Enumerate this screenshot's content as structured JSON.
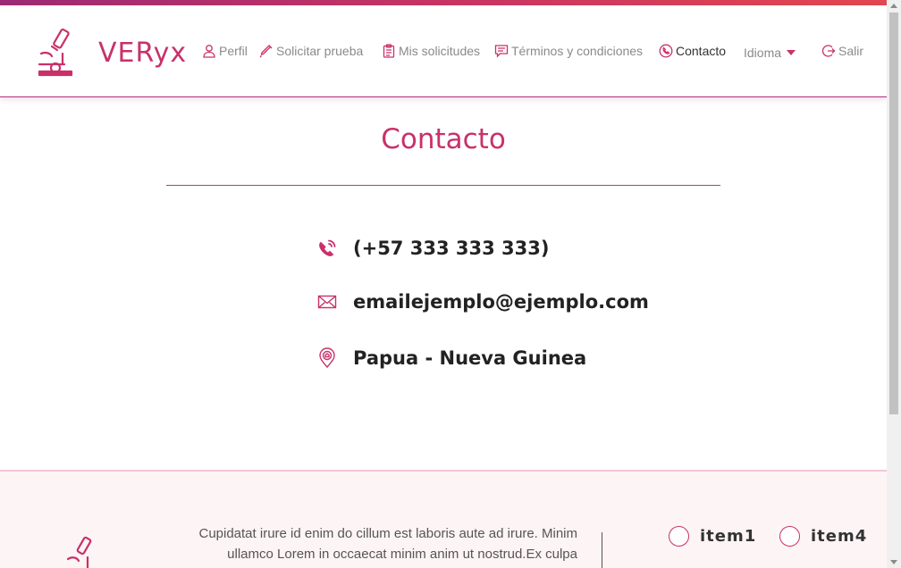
{
  "brand": {
    "name": "VERyx",
    "logo_icon": "microscope-icon"
  },
  "nav": {
    "items": [
      {
        "label": "Perfil",
        "icon": "user-icon"
      },
      {
        "label": "Solicitar prueba",
        "icon": "syringe-icon"
      },
      {
        "label": "Mis solicitudes",
        "icon": "clipboard-icon"
      },
      {
        "label": "Términos y condiciones",
        "icon": "message-icon"
      },
      {
        "label": "Contacto",
        "icon": "phone-icon",
        "active": true
      }
    ],
    "language": {
      "label": "Idioma",
      "icon": "caret-down-icon"
    },
    "logout": {
      "label": "Salir",
      "icon": "logout-icon"
    }
  },
  "page": {
    "title": "Contacto",
    "contacts": [
      {
        "icon": "phone-icon",
        "text": "(+57 333 333 333)"
      },
      {
        "icon": "mail-icon",
        "text": "emailejemplo@ejemplo.com"
      },
      {
        "icon": "location-pin-icon",
        "text": "Papua - Nueva Guinea"
      }
    ]
  },
  "footer": {
    "text_line1": "Cupidatat irure id enim do cillum est laboris aute ad irure. Minim",
    "text_line2": "ullamco Lorem in occaecat minim anim ut nostrud.Ex culpa",
    "options": [
      {
        "label": "item1"
      },
      {
        "label": "item4"
      }
    ]
  },
  "colors": {
    "accent": "#c9316a",
    "accent_dark": "#9c2a74",
    "footer_bg": "#fdf4f6"
  }
}
